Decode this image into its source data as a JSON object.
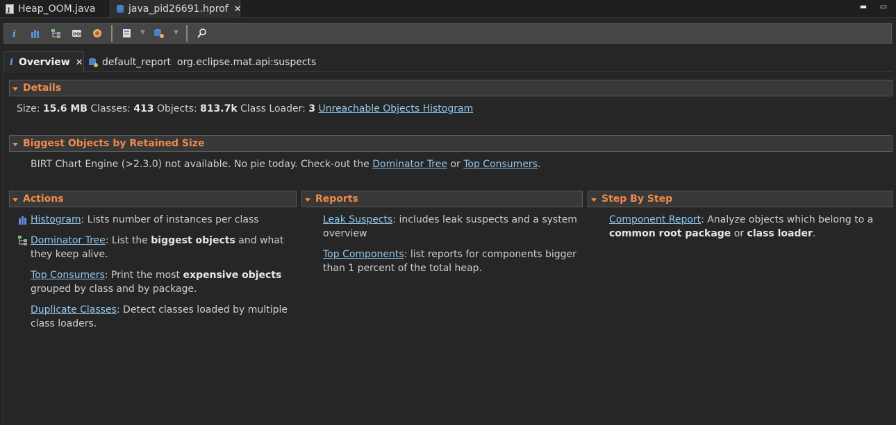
{
  "editor_tabs": [
    {
      "label": "Heap_OOM.java",
      "active": false
    },
    {
      "label": "java_pid26691.hprof",
      "active": true
    }
  ],
  "toolbar": {
    "buttons": [
      "info-icon",
      "histogram-icon",
      "dominator-tree-icon",
      "oql-icon",
      "thread-overview-icon",
      "query-browser-icon",
      "run-report-icon",
      "search-icon"
    ]
  },
  "inner_tabs": [
    {
      "label": "Overview",
      "active": true
    },
    {
      "label": "default_report  org.eclipse.mat.api:suspects",
      "active": false
    }
  ],
  "details": {
    "header": "Details",
    "size_label": "Size:",
    "size_value": "15.6 MB",
    "classes_label": "Classes:",
    "classes_value": "413",
    "objects_label": "Objects:",
    "objects_value": "813.7k",
    "loader_label": "Class Loader:",
    "loader_value": "3",
    "unreachable_link": "Unreachable Objects Histogram"
  },
  "biggest": {
    "header": "Biggest Objects by Retained Size",
    "text_before": "BIRT Chart Engine (>2.3.0) not available. No pie today. Check-out the",
    "link1": "Dominator Tree",
    "text_mid": "or",
    "link2": "Top Consumers",
    "text_after": "."
  },
  "actions": {
    "header": "Actions",
    "histogram": {
      "link": "Histogram",
      "desc": ": Lists number of instances per class"
    },
    "dominator": {
      "link": "Dominator Tree",
      "desc1": ": List the ",
      "bold": "biggest objects",
      "desc2": " and what",
      "desc3": "they keep alive."
    },
    "consumers": {
      "link": "Top Consumers",
      "desc1": ": Print the most ",
      "bold": "expensive objects",
      "desc2": "grouped by class and by package."
    },
    "duplicates": {
      "link": "Duplicate Classes",
      "desc1": ": Detect classes loaded by multiple",
      "desc2": "class loaders."
    }
  },
  "reports": {
    "header": "Reports",
    "leak": {
      "link": "Leak Suspects",
      "desc1": ": includes leak suspects and a system",
      "desc2": "overview"
    },
    "components": {
      "link": "Top Components",
      "desc1": ": list reports for components bigger",
      "desc2": "than 1 percent of the total heap."
    }
  },
  "stepbystep": {
    "header": "Step By Step",
    "component": {
      "link": "Component Report",
      "desc1": ": Analyze objects which belong to a",
      "bold1": "common root package",
      "mid": " or ",
      "bold2": "class loader",
      "end": "."
    }
  },
  "colors": {
    "accent": "#f08a4b",
    "link": "#8fc7ee",
    "background": "#262626"
  }
}
